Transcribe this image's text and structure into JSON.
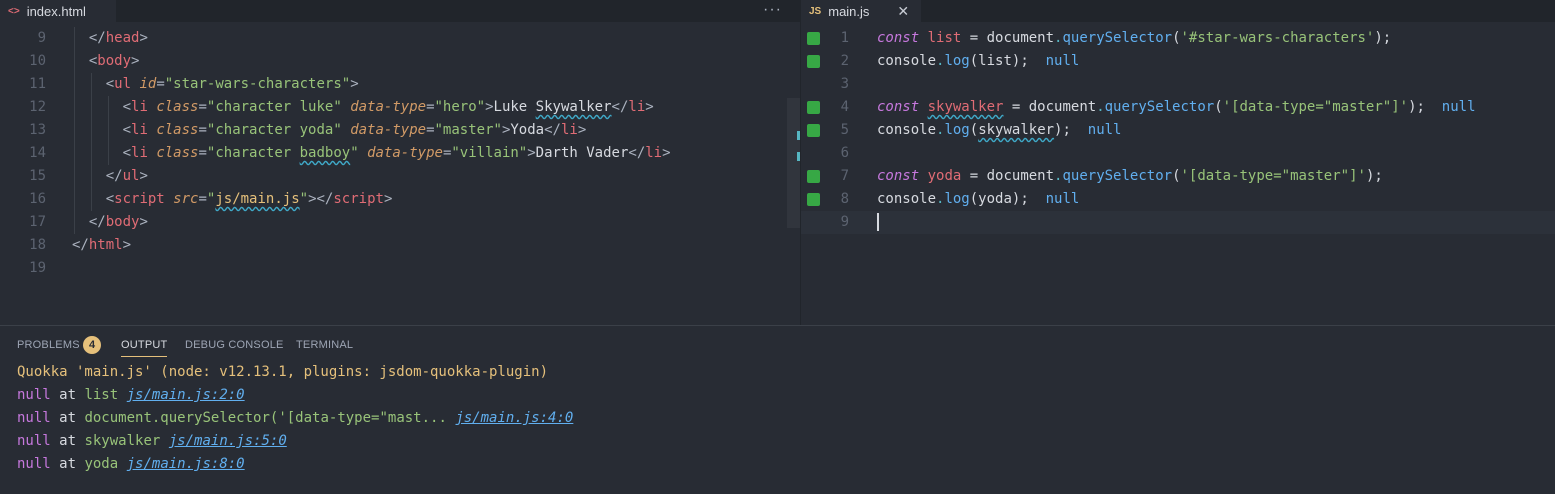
{
  "left_tab": {
    "icon": "<>",
    "label": "index.html",
    "more": "···"
  },
  "right_tab": {
    "icon": "JS",
    "label": "main.js",
    "close": "✕"
  },
  "left_code": [
    {
      "n": "9",
      "indent": 2,
      "tokens": [
        [
          "punc",
          "</"
        ],
        [
          "tag",
          "head"
        ],
        [
          "punc",
          ">"
        ]
      ]
    },
    {
      "n": "10",
      "indent": 2,
      "tokens": [
        [
          "punc",
          "<"
        ],
        [
          "tag",
          "body"
        ],
        [
          "punc",
          ">"
        ]
      ]
    },
    {
      "n": "11",
      "indent": 4,
      "tokens": [
        [
          "punc",
          "<"
        ],
        [
          "tag",
          "ul"
        ],
        [
          "plain",
          " "
        ],
        [
          "attr",
          "id"
        ],
        [
          "punc",
          "="
        ],
        [
          "str",
          "\"star-wars-characters\""
        ],
        [
          "punc",
          ">"
        ]
      ]
    },
    {
      "n": "12",
      "indent": 6,
      "tokens": [
        [
          "punc",
          "<"
        ],
        [
          "tag",
          "li"
        ],
        [
          "plain",
          " "
        ],
        [
          "attr",
          "class"
        ],
        [
          "punc",
          "="
        ],
        [
          "str",
          "\"character luke\""
        ],
        [
          "plain",
          " "
        ],
        [
          "attr",
          "data-type"
        ],
        [
          "punc",
          "="
        ],
        [
          "str",
          "\"hero\""
        ],
        [
          "punc",
          ">"
        ],
        [
          "plain",
          "Luke "
        ],
        [
          "plainsq",
          "Skywalker"
        ],
        [
          "punc",
          "</"
        ],
        [
          "tag",
          "li"
        ],
        [
          "punc",
          ">"
        ]
      ]
    },
    {
      "n": "13",
      "indent": 6,
      "tokens": [
        [
          "punc",
          "<"
        ],
        [
          "tag",
          "li"
        ],
        [
          "plain",
          " "
        ],
        [
          "attr",
          "class"
        ],
        [
          "punc",
          "="
        ],
        [
          "str",
          "\"character yoda\""
        ],
        [
          "plain",
          " "
        ],
        [
          "attr",
          "data-type"
        ],
        [
          "punc",
          "="
        ],
        [
          "str",
          "\"master\""
        ],
        [
          "punc",
          ">"
        ],
        [
          "plain",
          "Yoda"
        ],
        [
          "punc",
          "</"
        ],
        [
          "tag",
          "li"
        ],
        [
          "punc",
          ">"
        ]
      ]
    },
    {
      "n": "14",
      "indent": 6,
      "tokens": [
        [
          "punc",
          "<"
        ],
        [
          "tag",
          "li"
        ],
        [
          "plain",
          " "
        ],
        [
          "attr",
          "class"
        ],
        [
          "punc",
          "="
        ],
        [
          "str",
          "\"character "
        ],
        [
          "strsq",
          "badboy"
        ],
        [
          "str",
          "\""
        ],
        [
          "plain",
          " "
        ],
        [
          "attr",
          "data-type"
        ],
        [
          "punc",
          "="
        ],
        [
          "str",
          "\"villain\""
        ],
        [
          "punc",
          ">"
        ],
        [
          "plain",
          "Darth Vader"
        ],
        [
          "punc",
          "</"
        ],
        [
          "tag",
          "li"
        ],
        [
          "punc",
          ">"
        ]
      ]
    },
    {
      "n": "15",
      "indent": 4,
      "tokens": [
        [
          "punc",
          "</"
        ],
        [
          "tag",
          "ul"
        ],
        [
          "punc",
          ">"
        ]
      ]
    },
    {
      "n": "16",
      "indent": 4,
      "tokens": [
        [
          "punc",
          "<"
        ],
        [
          "tag",
          "script"
        ],
        [
          "plain",
          " "
        ],
        [
          "attr",
          "src"
        ],
        [
          "punc",
          "="
        ],
        [
          "str",
          "\""
        ],
        [
          "yelsq",
          "js/main.js"
        ],
        [
          "str",
          "\""
        ],
        [
          "punc",
          "></"
        ],
        [
          "tag",
          "script"
        ],
        [
          "punc",
          ">"
        ]
      ]
    },
    {
      "n": "17",
      "indent": 2,
      "tokens": [
        [
          "punc",
          "</"
        ],
        [
          "tag",
          "body"
        ],
        [
          "punc",
          ">"
        ]
      ]
    },
    {
      "n": "18",
      "indent": 0,
      "tokens": [
        [
          "punc",
          "</"
        ],
        [
          "tag",
          "html"
        ],
        [
          "punc",
          ">"
        ]
      ]
    },
    {
      "n": "19",
      "indent": 0,
      "tokens": []
    }
  ],
  "right_code": [
    {
      "n": "1",
      "mark": true,
      "tokens": [
        [
          "kw",
          "const"
        ],
        [
          "plain",
          " "
        ],
        [
          "var",
          "list"
        ],
        [
          "plain",
          " = "
        ],
        [
          "plain",
          "document"
        ],
        [
          "mem",
          "."
        ],
        [
          "fn",
          "querySelector"
        ],
        [
          "plain",
          "("
        ],
        [
          "str",
          "'#star-wars-characters'"
        ],
        [
          "plain",
          ");"
        ]
      ]
    },
    {
      "n": "2",
      "mark": true,
      "tokens": [
        [
          "plain",
          "console"
        ],
        [
          "mem",
          "."
        ],
        [
          "fn",
          "log"
        ],
        [
          "plain",
          "(list);  "
        ],
        [
          "nullc",
          "null"
        ]
      ]
    },
    {
      "n": "3",
      "mark": false,
      "tokens": []
    },
    {
      "n": "4",
      "mark": true,
      "tokens": [
        [
          "kw",
          "const"
        ],
        [
          "plain",
          " "
        ],
        [
          "varsq",
          "skywalker"
        ],
        [
          "plain",
          " = "
        ],
        [
          "plain",
          "document"
        ],
        [
          "mem",
          "."
        ],
        [
          "fn",
          "querySelector"
        ],
        [
          "plain",
          "("
        ],
        [
          "str",
          "'[data-type=\"master\"]'"
        ],
        [
          "plain",
          ");  "
        ],
        [
          "nullc",
          "null"
        ]
      ]
    },
    {
      "n": "5",
      "mark": true,
      "tokens": [
        [
          "plain",
          "console"
        ],
        [
          "mem",
          "."
        ],
        [
          "fn",
          "log"
        ],
        [
          "plain",
          "("
        ],
        [
          "plainsq",
          "skywalker"
        ],
        [
          "plain",
          ");  "
        ],
        [
          "nullc",
          "null"
        ]
      ]
    },
    {
      "n": "6",
      "mark": false,
      "tokens": []
    },
    {
      "n": "7",
      "mark": true,
      "tokens": [
        [
          "kw",
          "const"
        ],
        [
          "plain",
          " "
        ],
        [
          "var",
          "yoda"
        ],
        [
          "plain",
          " = "
        ],
        [
          "plain",
          "document"
        ],
        [
          "mem",
          "."
        ],
        [
          "fn",
          "querySelector"
        ],
        [
          "plain",
          "("
        ],
        [
          "str",
          "'[data-type=\"master\"]'"
        ],
        [
          "plain",
          ");"
        ]
      ]
    },
    {
      "n": "8",
      "mark": true,
      "tokens": [
        [
          "plain",
          "console"
        ],
        [
          "mem",
          "."
        ],
        [
          "fn",
          "log"
        ],
        [
          "plain",
          "(yoda);  "
        ],
        [
          "nullc",
          "null"
        ]
      ]
    },
    {
      "n": "9",
      "mark": false,
      "active": true,
      "tokens": []
    }
  ],
  "panel": {
    "tabs": [
      "PROBLEMS",
      "OUTPUT",
      "DEBUG CONSOLE",
      "TERMINAL"
    ],
    "problems_count": "4",
    "active_tab": "OUTPUT",
    "header": "Quokka 'main.js' (node: v12.13.1, plugins: jsdom-quokka-plugin)",
    "lines": [
      {
        "value": "null",
        "at": "at",
        "expr": "list",
        "link": "js/main.js:2:0"
      },
      {
        "value": "null",
        "at": "at",
        "expr": "document.querySelector('[data-type=\"mast...",
        "link": "js/main.js:4:0"
      },
      {
        "value": "null",
        "at": "at",
        "expr": "skywalker",
        "link": "js/main.js:5:0"
      },
      {
        "value": "null",
        "at": "at",
        "expr": "yoda",
        "link": "js/main.js:8:0"
      }
    ]
  },
  "colors": {
    "accent": "#e5c07b",
    "gutter_mark": "#37a845",
    "null": "#61afef"
  }
}
